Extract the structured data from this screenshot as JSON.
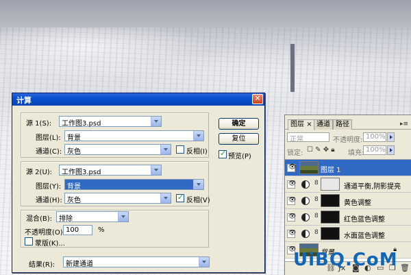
{
  "dialog": {
    "title": "计算",
    "close": "✕",
    "source1": {
      "label": "源 1(S):",
      "file": "工作图3.psd",
      "layer_label": "图层(L):",
      "layer_value": "背景",
      "channel_label": "通道(C):",
      "channel_value": "灰色",
      "invert_label": "反相(I)",
      "invert_checked": false
    },
    "source2": {
      "label": "源 2(U):",
      "file": "工作图3.psd",
      "layer_label": "图层(Y):",
      "layer_value": "背景",
      "channel_label": "通道(H):",
      "channel_value": "灰色",
      "invert_label": "反相(V)",
      "invert_checked": true
    },
    "blend": {
      "label": "混合(B):",
      "value": "排除",
      "opacity_label": "不透明度(O):",
      "opacity_value": "100",
      "opacity_unit": "%",
      "mask_label": "蒙版(K)...",
      "mask_checked": false
    },
    "result": {
      "label": "结果(R):",
      "value": "新建通道"
    },
    "buttons": {
      "ok": "确定",
      "cancel": "复位",
      "preview_label": "预览(P)",
      "preview_checked": true
    }
  },
  "layers_panel": {
    "tabs": [
      "图层",
      "通道",
      "路径"
    ],
    "tab_close": "×",
    "menu_glyph": "▸≡",
    "blend_mode": "正常",
    "opacity_label": "不透明度:",
    "opacity_value": "100%",
    "lock_label": "锁定:",
    "fill_label": "填充:",
    "fill_value": "100%",
    "layers": [
      {
        "name": "图层 1",
        "kind": "photo",
        "selected": true
      },
      {
        "name": "通道平衡,阴影提亮",
        "kind": "adjustment",
        "mask": "light"
      },
      {
        "name": "黄色调整",
        "kind": "adjustment",
        "mask": "dark"
      },
      {
        "name": "红色蓝色调整",
        "kind": "adjustment",
        "mask": "dark"
      },
      {
        "name": "水面蓝色调整",
        "kind": "adjustment",
        "mask": "dark"
      },
      {
        "name": "背景",
        "kind": "background",
        "locked": true
      }
    ]
  },
  "watermark": "UiBQ.CoM"
}
